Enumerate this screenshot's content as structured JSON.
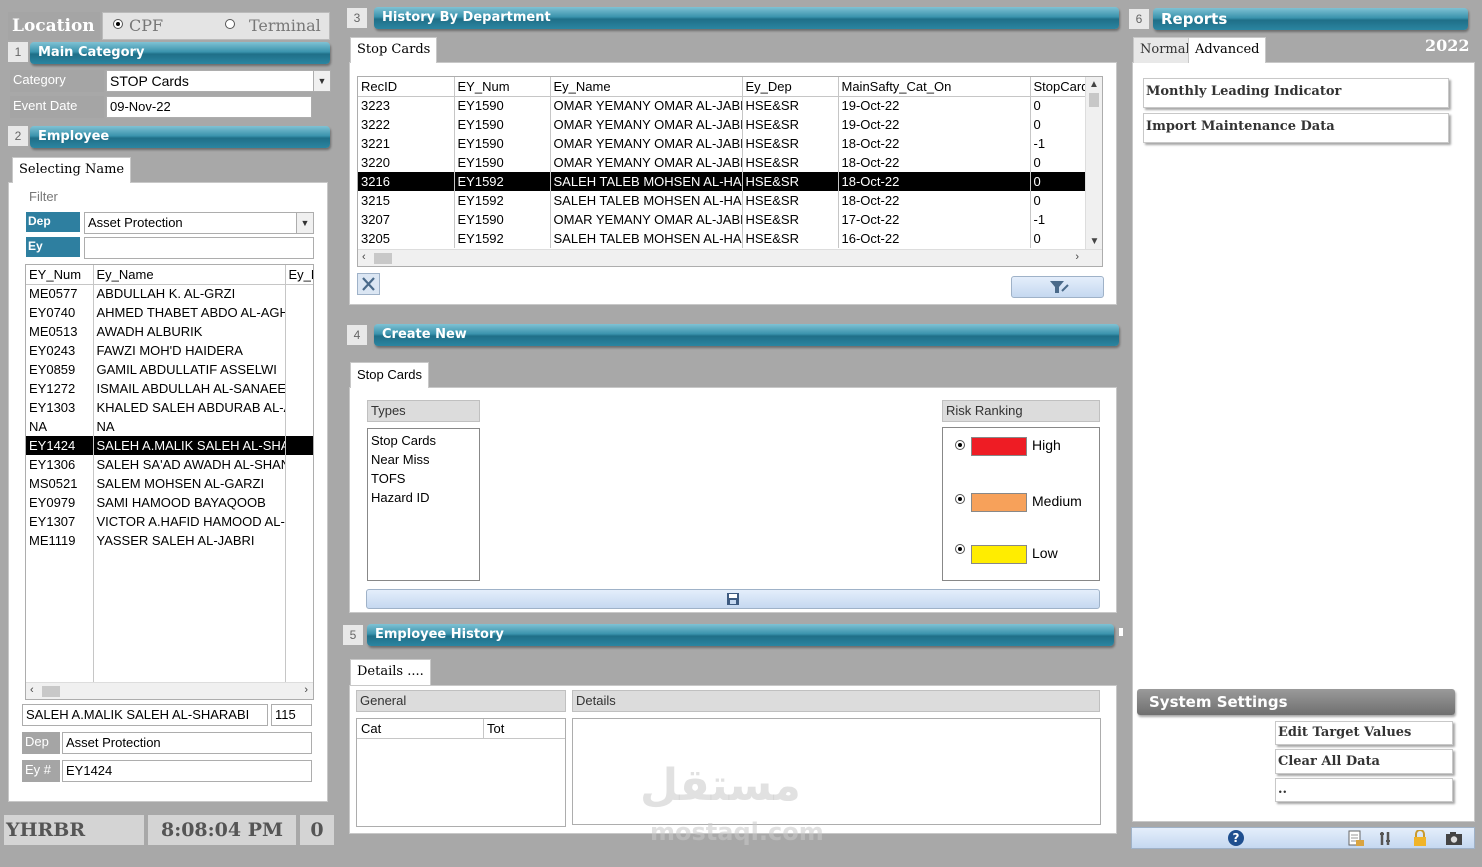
{
  "location": {
    "label": "Location",
    "options": [
      "CPF",
      "Terminal"
    ],
    "selected": "CPF"
  },
  "main_category": {
    "num": "1",
    "title": "Main Category",
    "category_label": "Category",
    "category_value": "STOP Cards",
    "event_date_label": "Event Date",
    "event_date_value": "09-Nov-22"
  },
  "employee": {
    "num": "2",
    "title": "Employee",
    "tab": "Selecting Name",
    "filter_label": "Filter",
    "dep_label": "Dep",
    "dep_value": "Asset Protection",
    "ey_label": "Ey",
    "ey_value": "",
    "columns": [
      "EY_Num",
      "Ey_Name",
      "Ey_D"
    ],
    "rows": [
      [
        "ME0577",
        "ABDULLAH K. AL-GRZI",
        ""
      ],
      [
        "EY0740",
        "AHMED THABET ABDO AL-AGHBARI",
        ""
      ],
      [
        "ME0513",
        "AWADH ALBURIK",
        ""
      ],
      [
        "EY0243",
        "FAWZI MOH'D HAIDERA",
        ""
      ],
      [
        "EY0859",
        "GAMIL ABDULLATIF ASSELWI",
        ""
      ],
      [
        "EY1272",
        "ISMAIL ABDULLAH AL-SANAEE",
        ""
      ],
      [
        "EY1303",
        "KHALED SALEH ABDURAB AL-AMRI",
        ""
      ],
      [
        "NA",
        "NA",
        ""
      ],
      [
        "EY1424",
        "SALEH A.MALIK SALEH AL-SHARABI",
        ""
      ],
      [
        "EY1306",
        "SALEH SA'AD AWADH AL-SHANBARI",
        ""
      ],
      [
        "MS0521",
        "SALEM MOHSEN AL-GARZI",
        ""
      ],
      [
        "EY0979",
        "SAMI HAMOOD BAYAQOOB",
        ""
      ],
      [
        "EY1307",
        "VICTOR A.HAFID HAMOOD AL-HAMDI",
        ""
      ],
      [
        "ME1119",
        "YASSER SALEH AL-JABRI",
        ""
      ]
    ],
    "selected_row": 8,
    "selected_name": "SALEH A.MALIK SALEH AL-SHARABI",
    "selected_count": "115",
    "sel_dep_label": "Dep",
    "sel_dep_value": "Asset Protection",
    "sel_ey_label": "Ey #",
    "sel_ey_value": "EY1424"
  },
  "status_bar": {
    "user": "YHRBR",
    "time": "8:08:04 PM",
    "count": "0"
  },
  "history": {
    "num": "3",
    "title": "History By Department",
    "tab": "Stop Cards",
    "columns": [
      "RecID",
      "EY_Num",
      "Ey_Name",
      "Ey_Dep",
      "MainSafty_Cat_On",
      "StopCards"
    ],
    "rows": [
      [
        "3223",
        "EY1590",
        "OMAR YEMANY OMAR AL-JABRI",
        "HSE&SR",
        "19-Oct-22",
        "0"
      ],
      [
        "3222",
        "EY1590",
        "OMAR YEMANY OMAR AL-JABRI",
        "HSE&SR",
        "19-Oct-22",
        "0"
      ],
      [
        "3221",
        "EY1590",
        "OMAR YEMANY OMAR AL-JABRI",
        "HSE&SR",
        "18-Oct-22",
        "-1"
      ],
      [
        "3220",
        "EY1590",
        "OMAR YEMANY OMAR AL-JABRI",
        "HSE&SR",
        "18-Oct-22",
        "0"
      ],
      [
        "3216",
        "EY1592",
        "SALEH TALEB MOHSEN AL-HACHIM",
        "HSE&SR",
        "18-Oct-22",
        "0"
      ],
      [
        "3215",
        "EY1592",
        "SALEH TALEB MOHSEN AL-HACHIM",
        "HSE&SR",
        "18-Oct-22",
        "0"
      ],
      [
        "3207",
        "EY1590",
        "OMAR YEMANY OMAR AL-JABRI",
        "HSE&SR",
        "17-Oct-22",
        "-1"
      ],
      [
        "3205",
        "EY1592",
        "SALEH TALEB MOHSEN AL-HACHIM",
        "HSE&SR",
        "16-Oct-22",
        "0"
      ]
    ],
    "selected_row": 4
  },
  "create_new": {
    "num": "4",
    "title": "Create New",
    "tab": "Stop Cards",
    "types_label": "Types",
    "types": [
      "Stop Cards",
      "Near Miss",
      "TOFS",
      "Hazard ID"
    ],
    "risk_label": "Risk Ranking",
    "risks": [
      {
        "label": "High",
        "color": "#ee1c24"
      },
      {
        "label": "Medium",
        "color": "#f7a15a"
      },
      {
        "label": "Low",
        "color": "#ffed00"
      }
    ]
  },
  "emp_history": {
    "num": "5",
    "title": "Employee History",
    "tab": "Details ....",
    "general_label": "General",
    "details_label": "Details",
    "cat_label": "Cat",
    "tot_label": "Tot"
  },
  "reports": {
    "num": "6",
    "title": "Reports",
    "tabs": [
      "Normal",
      "Advanced"
    ],
    "active_tab": "Advanced",
    "year": "2022",
    "buttons": [
      "Monthly Leading Indicator",
      "Import Maintenance Data"
    ]
  },
  "system_settings": {
    "title": "System Settings",
    "buttons": [
      "Edit Target Values",
      "Clear All Data",
      ".."
    ]
  },
  "watermark": {
    "arabic": "مستقل",
    "latin": "mostaql.com"
  }
}
